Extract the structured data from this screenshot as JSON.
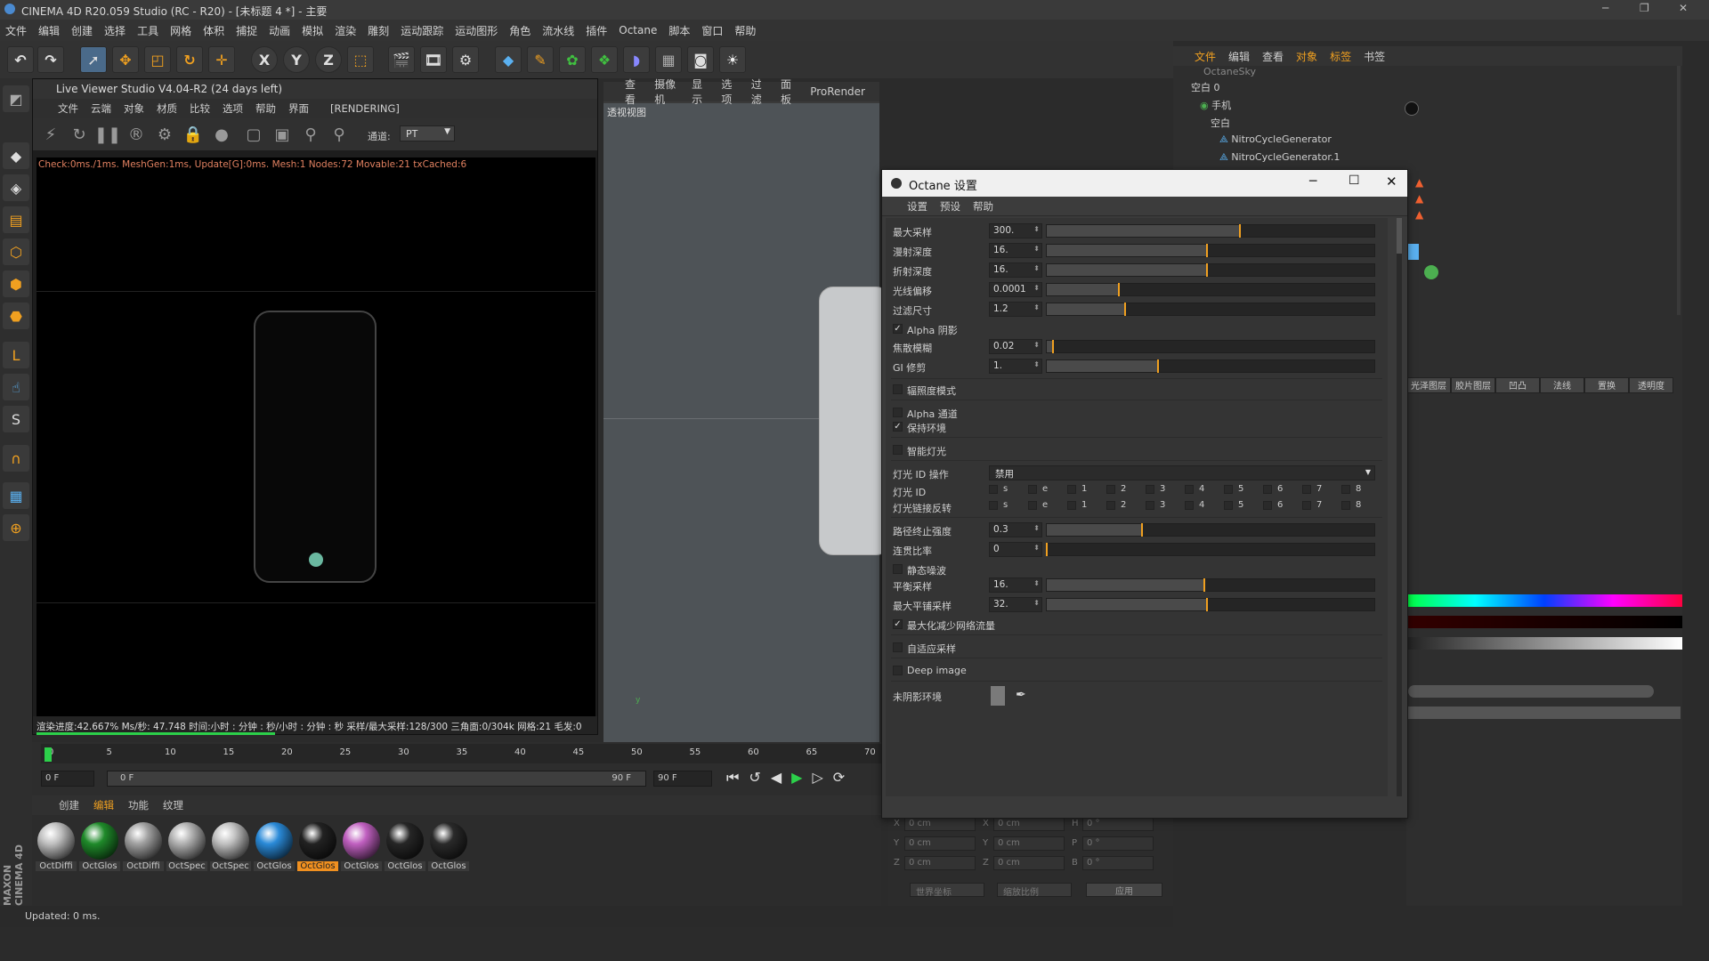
{
  "app": {
    "title": "CINEMA 4D R20.059 Studio (RC - R20) - [未标题 4 *] - 主要"
  },
  "menu": [
    "文件",
    "编辑",
    "创建",
    "选择",
    "工具",
    "网格",
    "体积",
    "捕捉",
    "动画",
    "模拟",
    "渲染",
    "雕刻",
    "运动跟踪",
    "运动图形",
    "角色",
    "流水线",
    "插件",
    "Octane",
    "脚本",
    "窗口",
    "帮助"
  ],
  "toolbar": {
    "x_label": "X",
    "y_label": "Y",
    "z_label": "Z"
  },
  "live_viewer": {
    "title": "Live Viewer Studio V4.04-R2 (24 days left)",
    "menu": [
      "文件",
      "云端",
      "对象",
      "材质",
      "比较",
      "选项",
      "帮助",
      "界面"
    ],
    "state": "[RENDERING]",
    "channel_label": "通道:",
    "channel_value": "PT",
    "status": "Check:0ms./1ms. MeshGen:1ms, Update[G]:0ms. Mesh:1 Nodes:72 Movable:21 txCached:6",
    "info": "渲染进度:42.667%   Ms/秒: 47.748    时间:小时 : 分钟 : 秒/小时 : 分钟 : 秒    采样/最大采样:128/300    三角面:0/304k    网格:21  毛发:0",
    "progress": 0.427
  },
  "viewport": {
    "menu": [
      "查看",
      "摄像机",
      "显示",
      "选项",
      "过滤",
      "面板",
      "ProRender"
    ],
    "label": "透视视图"
  },
  "timeline": {
    "ticks": [
      "0",
      "5",
      "10",
      "15",
      "20",
      "25",
      "30",
      "35",
      "40",
      "45",
      "50",
      "55",
      "60",
      "65",
      "70"
    ],
    "start": "0 F",
    "range_start": "0 F",
    "range_end": "90 F",
    "end": "90 F"
  },
  "materials": {
    "tabs": [
      "创建",
      "编辑",
      "功能",
      "纹理"
    ],
    "items": [
      {
        "name": "OctDiffi",
        "color": "#bfbfbf"
      },
      {
        "name": "OctGlos",
        "color": "#1f8a2a"
      },
      {
        "name": "OctDiffi",
        "color": "#a0a0a0"
      },
      {
        "name": "OctSpec",
        "color": "#b0b0b0"
      },
      {
        "name": "OctSpec",
        "color": "#c0c0c0"
      },
      {
        "name": "OctGlos",
        "color": "#2a8ad8"
      },
      {
        "name": "OctGlos",
        "color": "#222222"
      },
      {
        "name": "OctGlos",
        "color": "#c060c0"
      },
      {
        "name": "OctGlos",
        "color": "#262626"
      },
      {
        "name": "OctGlos",
        "color": "#2a2a2a"
      }
    ]
  },
  "statusbar": {
    "text": "Updated: 0 ms."
  },
  "object_manager": {
    "menu": [
      "文件",
      "编辑",
      "查看",
      "对象",
      "标签",
      "书签"
    ],
    "rows": [
      "OctaneSky",
      "空白 0",
      "手机",
      "空白",
      "NitroCycleGenerator",
      "NitroCycleGenerator.1"
    ]
  },
  "attr_tabs": [
    "光泽图层",
    "胶片图层",
    "凹凸",
    "法线",
    "置换",
    "透明度"
  ],
  "coords": {
    "rows": [
      {
        "a": "X",
        "av": "0 cm",
        "b": "X",
        "bv": "0 cm",
        "c": "H",
        "cv": "0 °"
      },
      {
        "a": "Y",
        "av": "0 cm",
        "b": "Y",
        "bv": "0 cm",
        "c": "P",
        "cv": "0 °"
      },
      {
        "a": "Z",
        "av": "0 cm",
        "b": "Z",
        "bv": "0 cm",
        "c": "B",
        "cv": "0 °"
      }
    ],
    "world": "世界坐标",
    "scale": "缩放比例",
    "apply": "应用"
  },
  "dialog": {
    "title": "Octane 设置",
    "menu": [
      "设置",
      "预设",
      "帮助"
    ],
    "max_samples": {
      "label": "最大采样",
      "value": "300.",
      "pct": 0.59
    },
    "diffuse_depth": {
      "label": "漫射深度",
      "value": "16.",
      "pct": 0.49
    },
    "specular_depth": {
      "label": "折射深度",
      "value": "16.",
      "pct": 0.49
    },
    "ray_eps": {
      "label": "光线偏移",
      "value": "0.0001",
      "pct": 0.22
    },
    "filter_size": {
      "label": "过滤尺寸",
      "value": "1.2",
      "pct": 0.24
    },
    "alpha_shadows": {
      "label": "Alpha 阴影",
      "checked": true
    },
    "caustic_blur": {
      "label": "焦散模糊",
      "value": "0.02",
      "pct": 0.02
    },
    "gi_clamp": {
      "label": "GI 修剪",
      "value": "1.",
      "pct": 0.34
    },
    "irradiance": {
      "label": "辐照度模式",
      "checked": false
    },
    "alpha_channel": {
      "label": "Alpha 通道",
      "checked": false
    },
    "keep_env": {
      "label": "保持环境",
      "checked": true
    },
    "smart_light": {
      "label": "智能灯光",
      "checked": false
    },
    "light_id_action": {
      "label": "灯光 ID 操作",
      "value": "禁用"
    },
    "light_ids": {
      "label": "灯光 ID",
      "ids": [
        "s",
        "e",
        "1",
        "2",
        "3",
        "4",
        "5",
        "6",
        "7",
        "8"
      ]
    },
    "light_linking": {
      "label": "灯光链接反转",
      "ids": [
        "s",
        "e",
        "1",
        "2",
        "3",
        "4",
        "5",
        "6",
        "7",
        "8"
      ]
    },
    "path_term": {
      "label": "路径终止强度",
      "value": "0.3",
      "pct": 0.29
    },
    "coherent": {
      "label": "连贯比率",
      "value": "0",
      "pct": 0.0
    },
    "static_noise": {
      "label": "静态噪波",
      "checked": false
    },
    "parallel": {
      "label": "平衡采样",
      "value": "16.",
      "pct": 0.48
    },
    "max_parallel": {
      "label": "最大平铺采样",
      "value": "32.",
      "pct": 0.49
    },
    "minimize_net": {
      "label": "最大化减少网络流量",
      "checked": true
    },
    "adaptive": {
      "label": "自适应采样",
      "checked": false
    },
    "deep_image": {
      "label": "Deep image",
      "checked": false
    },
    "shadow_env": {
      "label": "未阴影环境"
    }
  }
}
